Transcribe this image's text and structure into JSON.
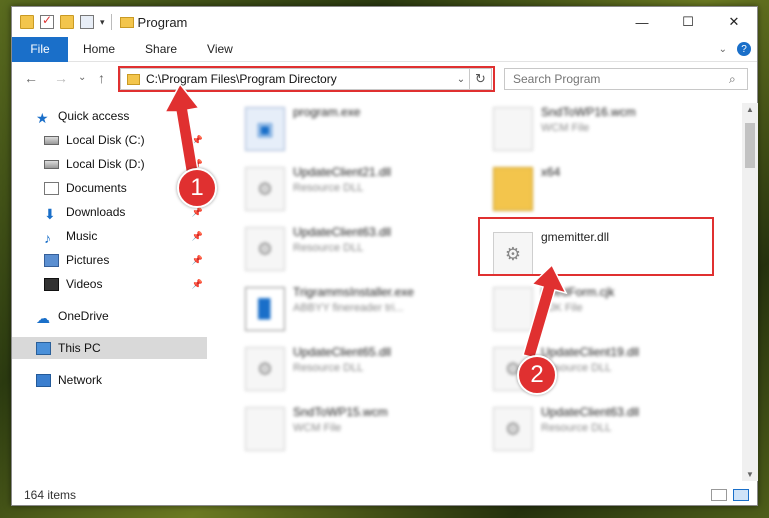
{
  "window": {
    "title": "Program",
    "controls": {
      "minimize": "—",
      "maximize": "☐",
      "close": "✕"
    }
  },
  "ribbon": {
    "tabs": [
      "File",
      "Home",
      "Share",
      "View"
    ],
    "expand_icon": "chevron-down-icon",
    "help": "?"
  },
  "nav": {
    "back": "←",
    "forward": "→",
    "recent": "⌄",
    "up": "↑"
  },
  "address": {
    "path": "C:\\Program Files\\Program Directory",
    "refresh": "↻"
  },
  "search": {
    "placeholder": "Search Program",
    "icon": "⌕"
  },
  "sidebar": {
    "items": [
      {
        "label": "Quick access",
        "icon": "star-icon"
      },
      {
        "label": "Local Disk (C:)",
        "icon": "disk-icon",
        "pinned": true
      },
      {
        "label": "Local Disk (D:)",
        "icon": "disk-icon",
        "pinned": true
      },
      {
        "label": "Documents",
        "icon": "document-icon",
        "pinned": true
      },
      {
        "label": "Downloads",
        "icon": "download-icon",
        "pinned": true
      },
      {
        "label": "Music",
        "icon": "music-icon",
        "pinned": true
      },
      {
        "label": "Pictures",
        "icon": "pictures-icon",
        "pinned": true
      },
      {
        "label": "Videos",
        "icon": "video-icon",
        "pinned": true
      },
      {
        "label": "OneDrive",
        "icon": "cloud-icon"
      },
      {
        "label": "This PC",
        "icon": "pc-icon",
        "selected": true
      },
      {
        "label": "Network",
        "icon": "network-icon"
      }
    ]
  },
  "files": [
    {
      "name": "program.exe",
      "type": ""
    },
    {
      "name": "SndToWP16.wcm",
      "type": "WCM File"
    },
    {
      "name": "UpdateClient21.dll",
      "type": "Resource DLL"
    },
    {
      "name": "x64",
      "type": ""
    },
    {
      "name": "UpdateClient63.dll",
      "type": "Resource DLL"
    },
    {
      "name": "gmemitter.dll",
      "type": ""
    },
    {
      "name": "TrigrammsInstaller.exe",
      "type": "ABBYY finereader tri..."
    },
    {
      "name": "FeedForm.cjk",
      "type": "CJK File"
    },
    {
      "name": "UpdateClient65.dll",
      "type": "Resource DLL"
    },
    {
      "name": "UpdateClient19.dll",
      "type": "Resource DLL"
    },
    {
      "name": "SndToWP15.wcm",
      "type": "WCM File"
    },
    {
      "name": "UpdateClient63.dll",
      "type": "Resource DLL"
    }
  ],
  "status": {
    "item_count": "164 items"
  },
  "annotations": {
    "step1": "1",
    "step2": "2",
    "color": "#e03030"
  }
}
